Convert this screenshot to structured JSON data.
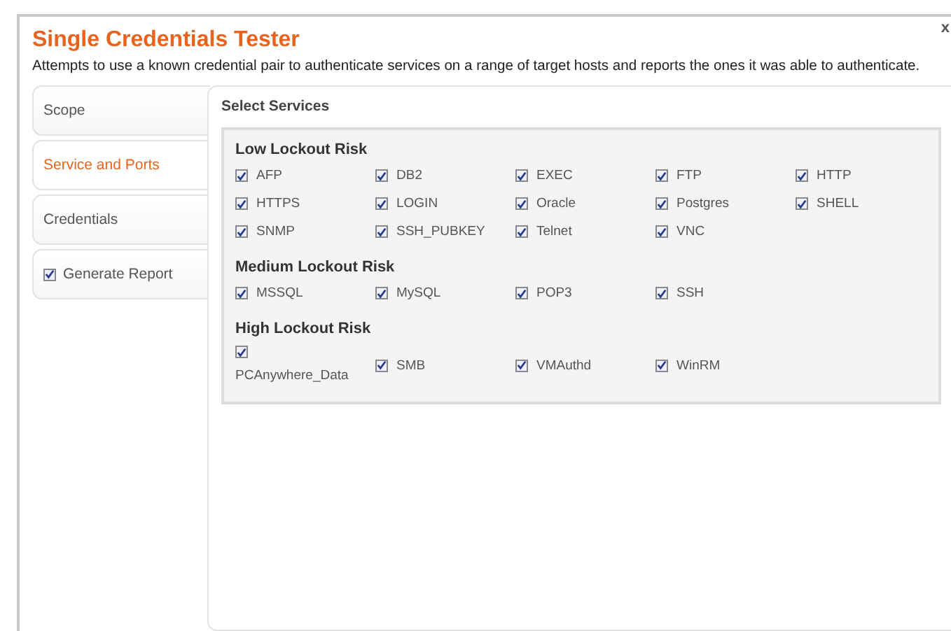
{
  "dialog": {
    "title": "Single Credentials Tester",
    "description": "Attempts to use a known credential pair to authenticate services on a range of target hosts and reports the ones it was able to authenticate.",
    "close": "x"
  },
  "tabs": [
    {
      "label": "Scope",
      "kind": "plain",
      "selected": false
    },
    {
      "label": "Service and Ports",
      "kind": "plain",
      "selected": true
    },
    {
      "label": "Credentials",
      "kind": "plain",
      "selected": false
    },
    {
      "label": "Generate Report",
      "kind": "checkbox",
      "checked": true,
      "selected": false
    }
  ],
  "panel": {
    "title": "Select Services",
    "groups": [
      {
        "title": "Low Lockout Risk",
        "services": [
          {
            "label": "AFP",
            "checked": true
          },
          {
            "label": "DB2",
            "checked": true
          },
          {
            "label": "EXEC",
            "checked": true
          },
          {
            "label": "FTP",
            "checked": true
          },
          {
            "label": "HTTP",
            "checked": true
          },
          {
            "label": "HTTPS",
            "checked": true
          },
          {
            "label": "LOGIN",
            "checked": true
          },
          {
            "label": "Oracle",
            "checked": true
          },
          {
            "label": "Postgres",
            "checked": true
          },
          {
            "label": "SHELL",
            "checked": true
          },
          {
            "label": "SNMP",
            "checked": true
          },
          {
            "label": "SSH_PUBKEY",
            "checked": true
          },
          {
            "label": "Telnet",
            "checked": true
          },
          {
            "label": "VNC",
            "checked": true
          }
        ]
      },
      {
        "title": "Medium Lockout Risk",
        "services": [
          {
            "label": "MSSQL",
            "checked": true
          },
          {
            "label": "MySQL",
            "checked": true
          },
          {
            "label": "POP3",
            "checked": true
          },
          {
            "label": "SSH",
            "checked": true
          }
        ]
      },
      {
        "title": "High Lockout Risk",
        "services": [
          {
            "label": "PCAnywhere_Data",
            "checked": true
          },
          {
            "label": "SMB",
            "checked": true
          },
          {
            "label": "VMAuthd",
            "checked": true
          },
          {
            "label": "WinRM",
            "checked": true
          }
        ]
      }
    ]
  }
}
